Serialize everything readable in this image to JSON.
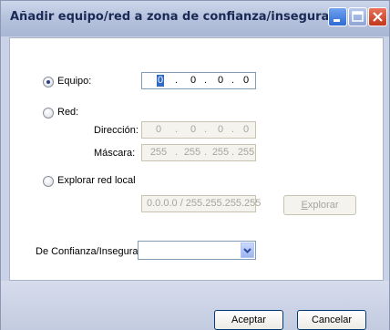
{
  "window": {
    "title": "Añadir equipo/red a zona de confianza/insegura"
  },
  "equipo": {
    "label": "Equipo:",
    "selected": true,
    "octets": [
      "0",
      "0",
      "0",
      "0"
    ]
  },
  "red": {
    "label": "Red:",
    "selected": false,
    "direccion_label": "Dirección:",
    "direccion_octets": [
      "0",
      "0",
      "0",
      "0"
    ],
    "mascara_label": "Máscara:",
    "mascara_octets": [
      "255",
      "255",
      "255",
      "255"
    ]
  },
  "explorar": {
    "label": "Explorar red local",
    "selected": false,
    "value": "0.0.0.0 / 255.255.255.255",
    "button_label": "Explorar",
    "button_underline": "E"
  },
  "zona": {
    "label": "De Confianza/Insegura",
    "value": ""
  },
  "buttons": {
    "accept_label": "Aceptar",
    "cancel_label": "Cancelar"
  },
  "colors": {
    "title_text": "#1b2a55",
    "selection": "#316ac5",
    "disabled_text": "#a7a59a"
  }
}
